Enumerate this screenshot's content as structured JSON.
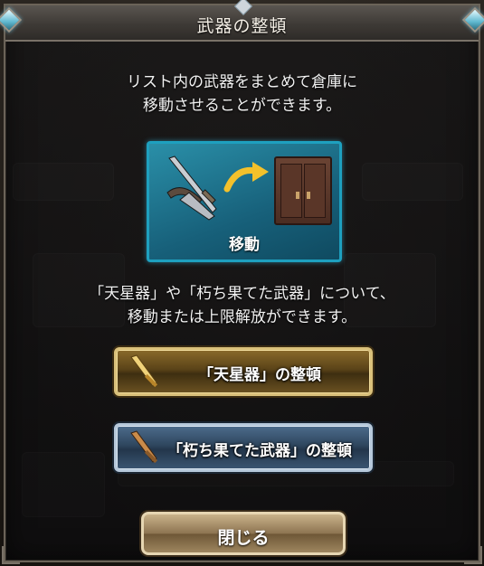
{
  "dialog": {
    "title": "武器の整頓",
    "description_line1": "リスト内の武器をまとめて倉庫に",
    "description_line2": "移動させることができます。",
    "move_label": "移動",
    "info_line1": "「天星器」や「朽ち果てた武器」について、",
    "info_line2": "移動または上限解放ができます。",
    "buttons": {
      "seraphic": "「天星器」の整頓",
      "decrepit": "「朽ち果てた武器」の整頓",
      "close": "閉じる"
    }
  },
  "icons": {
    "title_notch": "diamond-ornament-icon",
    "corner_gem": "crystal-gem-icon",
    "move_arrow": "curved-arrow-icon",
    "weapons": "weapon-pile-icon",
    "cabinet": "storage-cabinet-icon",
    "sword": "sword-icon"
  },
  "colors": {
    "gold_button": "#d9c07a",
    "blue_button": "#b6c8da",
    "move_panel": "#1ea0bf",
    "title_bar": "#4a4540"
  }
}
